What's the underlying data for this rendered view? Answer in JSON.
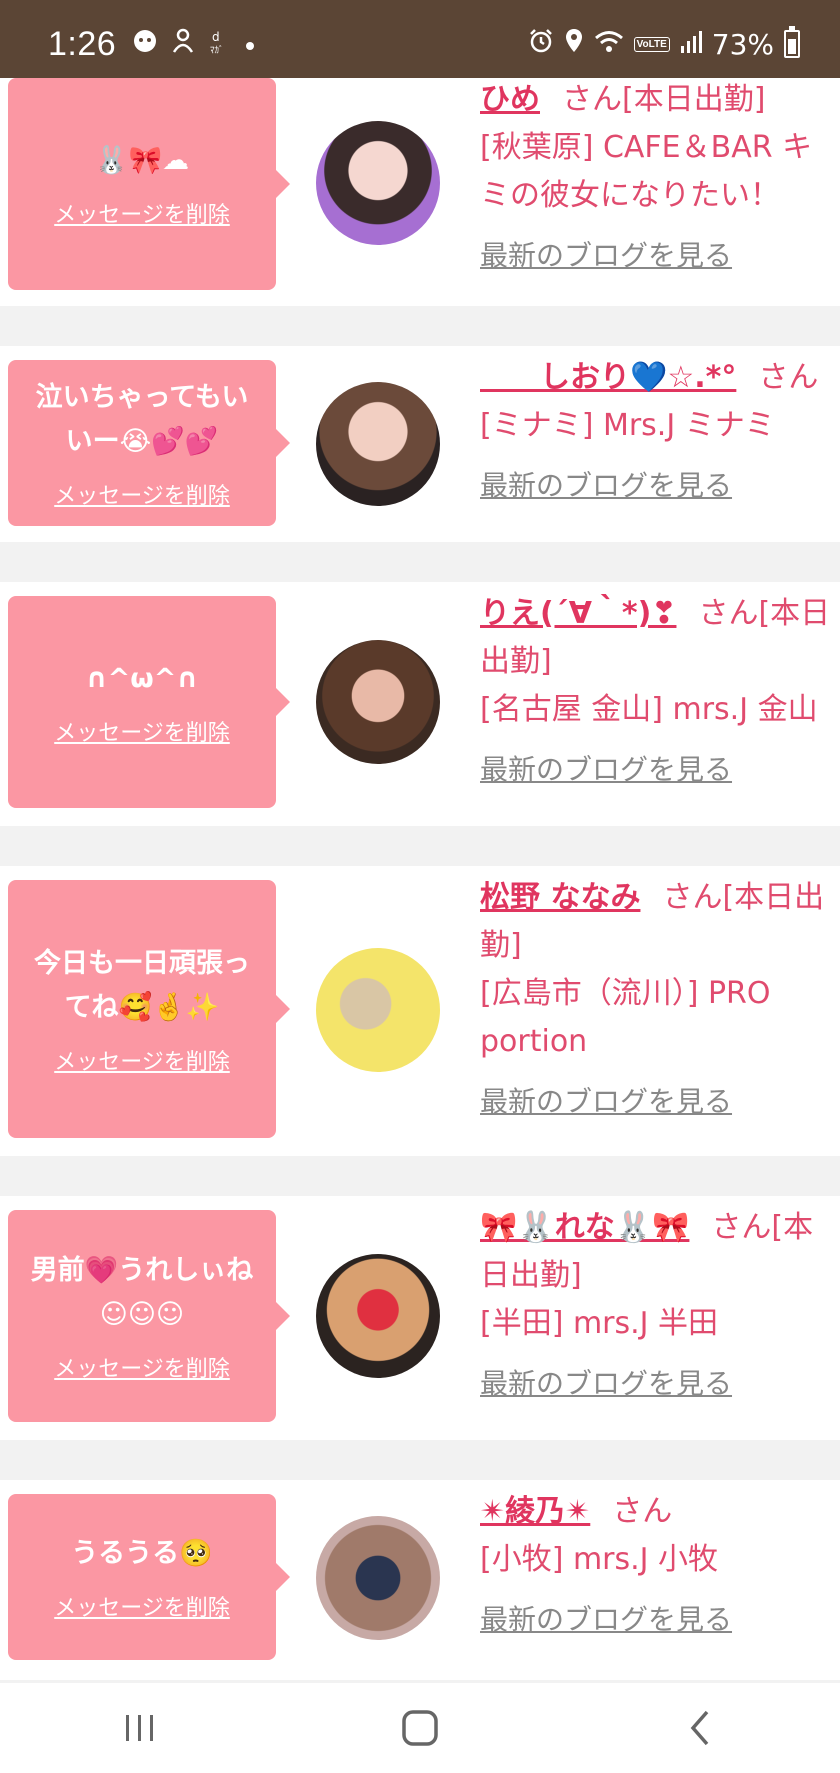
{
  "status_bar": {
    "time": "1:26",
    "battery": "73%",
    "volte": "VoLTE",
    "notification_icons": [
      "chat-app-icon",
      "person-icon",
      "dmagazine-icon",
      "dot-icon"
    ],
    "battery_level": 0.73
  },
  "messages": [
    {
      "message": "🐰🎀☁",
      "delete_label": "メッセージを削除",
      "name": "ひめ",
      "suffix": "さん[本日出勤]",
      "shop": "[秋葉原] CAFE＆BAR キミの彼女になりたい！",
      "blog": "最新のブログを見る"
    },
    {
      "message": "泣いちゃってもいいー😭💕💕",
      "delete_label": "メッセージを削除",
      "name": "　　しおり💙☆.*°",
      "suffix": "さん",
      "shop": "[ミナミ] Mrs.J ミナミ",
      "blog": "最新のブログを見る"
    },
    {
      "message": "∩^ω^∩",
      "delete_label": "メッセージを削除",
      "name": "りえ(´∀｀*)❣",
      "suffix": "さん[本日出勤]",
      "shop": "[名古屋 金山] mrs.J 金山",
      "blog": "最新のブログを見る"
    },
    {
      "message": "今日も一日頑張ってね🥰🤞✨",
      "delete_label": "メッセージを削除",
      "name": "松野 ななみ",
      "suffix": "さん[本日出勤]",
      "shop": "[広島市（流川）] PRO portion",
      "blog": "最新のブログを見る"
    },
    {
      "message": "男前💗うれしぃね☺☺☺",
      "delete_label": "メッセージを削除",
      "name": "🎀🐰れな🐰🎀",
      "suffix": "さん[本日出勤]",
      "shop": "[半田] mrs.J 半田",
      "blog": "最新のブログを見る"
    },
    {
      "message": "うるうる🥺",
      "delete_label": "メッセージを削除",
      "name": "✴綾乃✴",
      "suffix": "さん",
      "shop": "[小牧] mrs.J 小牧",
      "blog": "最新のブログを見る"
    }
  ],
  "colors": {
    "status_bar": "#5b4535",
    "bubble": "#fb97a3",
    "accent_text": "#e04b6e",
    "link_gray": "#888888",
    "separator": "#f2f2f2"
  },
  "nav": {
    "icons": [
      "recent-apps-icon",
      "home-icon",
      "back-icon"
    ]
  }
}
